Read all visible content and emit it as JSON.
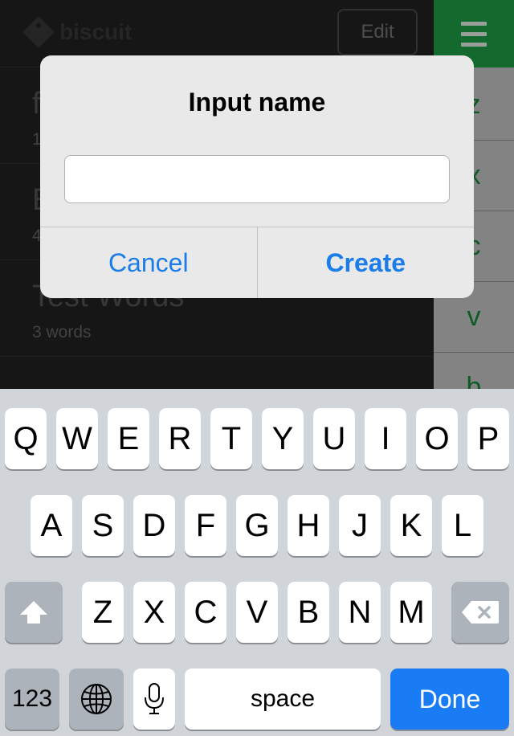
{
  "app": {
    "logo_text": "biscuit",
    "edit_label": "Edit",
    "lists": [
      {
        "title": "f",
        "subtitle": "1"
      },
      {
        "title": "E",
        "subtitle": "4"
      },
      {
        "title": "Test Words",
        "subtitle": "3 words"
      }
    ],
    "letters": [
      "z",
      "x",
      "c",
      "v",
      "b"
    ],
    "accent_color": "#1fa347"
  },
  "alert": {
    "title": "Input name",
    "input_value": "",
    "input_placeholder": "",
    "cancel_label": "Cancel",
    "create_label": "Create",
    "button_color": "#1a7dea"
  },
  "keyboard": {
    "row1": [
      "Q",
      "W",
      "E",
      "R",
      "T",
      "Y",
      "U",
      "I",
      "O",
      "P"
    ],
    "row2": [
      "A",
      "S",
      "D",
      "F",
      "G",
      "H",
      "J",
      "K",
      "L"
    ],
    "row3": [
      "Z",
      "X",
      "C",
      "V",
      "B",
      "N",
      "M"
    ],
    "numbers_label": "123",
    "space_label": "space",
    "done_label": "Done"
  }
}
